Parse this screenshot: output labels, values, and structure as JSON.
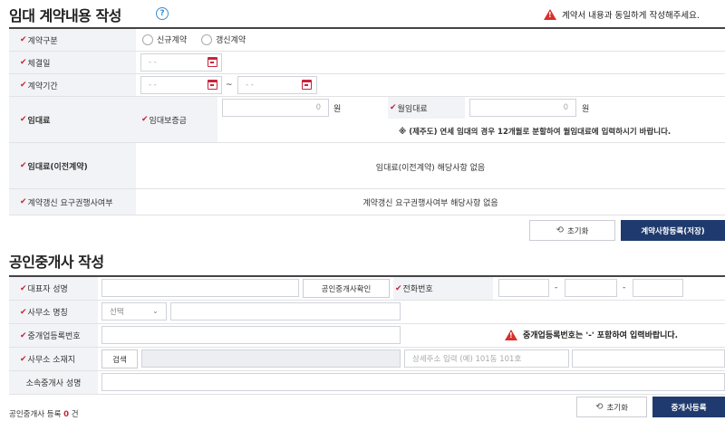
{
  "lease": {
    "title": "임대 계약내용 작성",
    "help_glyph": "?",
    "warning": "계약서 내용과 동일하게 작성해주세요.",
    "contract_type_label": "계약구분",
    "contract_type_options": [
      "신규계약",
      "갱신계약"
    ],
    "sign_date_label": "체결일",
    "sign_date_placeholder": "- -",
    "period_label": "계약기간",
    "period_start_placeholder": "- -",
    "period_separator": "~",
    "period_end_placeholder": "- -",
    "rent_label": "임대료",
    "deposit_label": "임대보증금",
    "deposit_value": "0",
    "deposit_unit": "원",
    "monthly_label": "월임대료",
    "monthly_value": "0",
    "monthly_unit": "원",
    "jeju_note": "※ (제주도) 연세 임대의 경우 12개월로 분할하여 월임대료에 입력하시기 바랍니다.",
    "prev_rent_label": "임대료(이전계약)",
    "prev_rent_text": "임대료(이전계약) 해당사항 없음",
    "renewal_label": "계약갱신 요구권행사여부",
    "renewal_text": "계약갱신 요구권행사여부 해당사항 없음",
    "reset_label": "초기화",
    "register_label": "계약사항등록(저장)"
  },
  "agent": {
    "title": "공인중개사 작성",
    "rep_name_label": "대표자 성명",
    "verify_button": "공인중개사확인",
    "phone_label": "전화번호",
    "phone_separators": [
      "-",
      "-"
    ],
    "office_name_label": "사무소 명칭",
    "office_select": "선택",
    "reg_number_label": "중개업등록번호",
    "reg_warning": "중개업등록번호는 '-' 포함하여 입력바랍니다.",
    "office_address_label": "사무소 소재지",
    "search_button": "검색",
    "address_detail_placeholder": "상세주소 입력 (예) 101동 101호",
    "affiliated_label": "소속중개사 성명",
    "count_prefix": "공인중개사 등록",
    "count_value": "0",
    "count_suffix": "건",
    "reset_label": "초기화",
    "register_label": "중개사등록"
  },
  "colors": {
    "required_mark": "#c8243b",
    "primary_button": "#1f3a6e",
    "label_bg": "#f2f3f6",
    "help_icon": "#3a8fd8",
    "warning_icon": "#d9302c"
  }
}
